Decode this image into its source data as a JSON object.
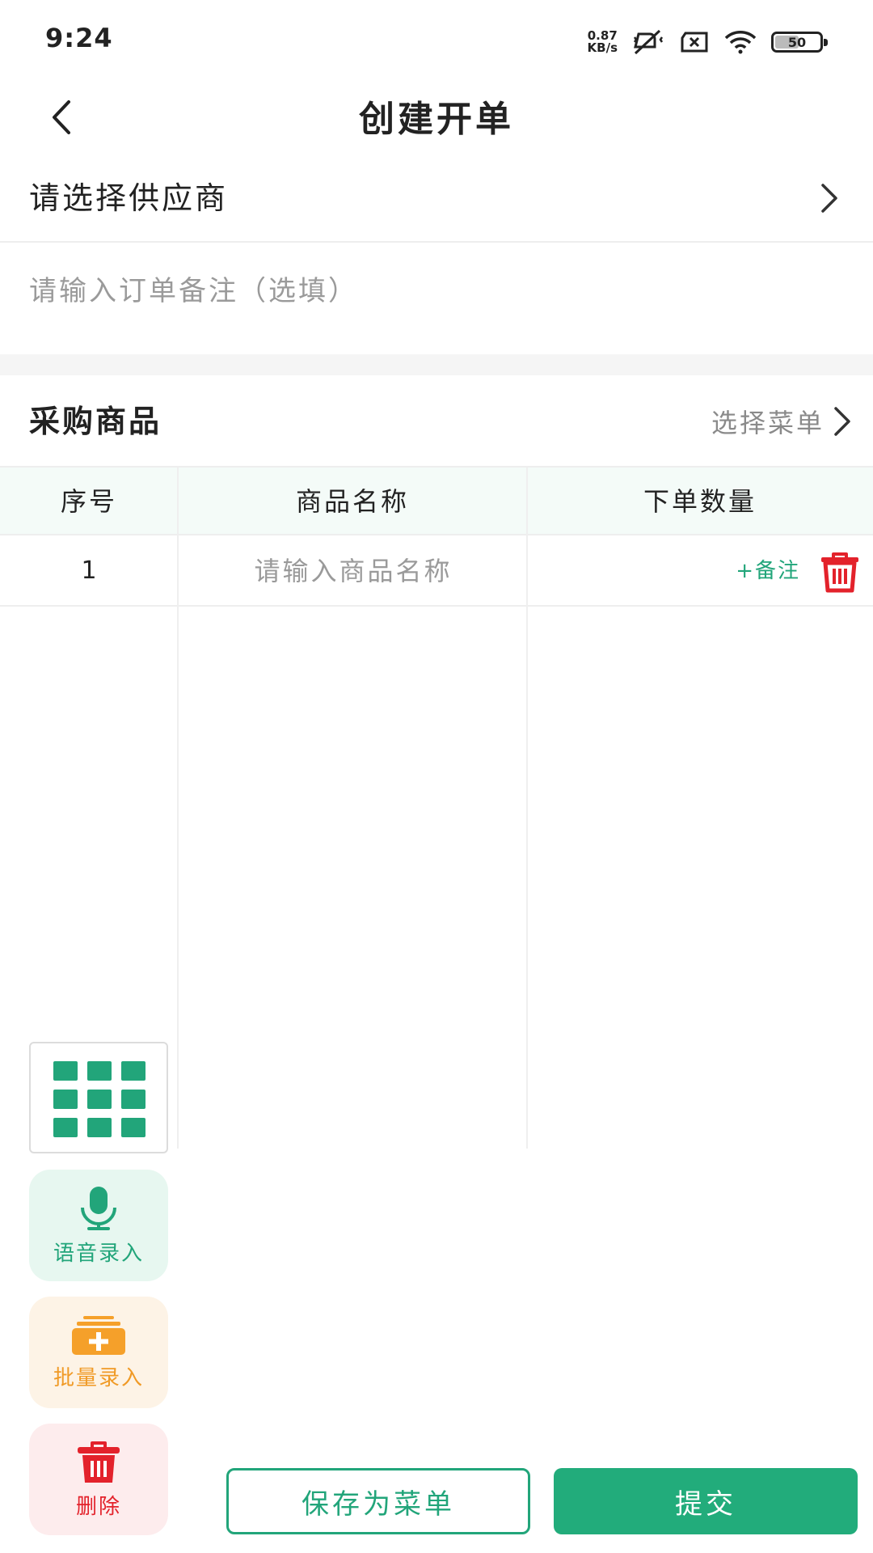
{
  "status_bar": {
    "time": "9:24",
    "net_speed_value": "0.87",
    "net_speed_unit": "KB/s",
    "battery_level": "50",
    "icons": [
      "net-speed-icon",
      "vibrate-off-icon",
      "sim-off-icon",
      "wifi-icon",
      "battery-icon"
    ]
  },
  "nav": {
    "title": "创建开单",
    "back_icon": "back-arrow-icon"
  },
  "supplier": {
    "label": "请选择供应商"
  },
  "remark": {
    "placeholder": "请输入订单备注（选填）"
  },
  "section": {
    "title": "采购商品",
    "choose_menu_label": "选择菜单"
  },
  "table": {
    "headers": [
      "序号",
      "商品名称",
      "下单数量"
    ],
    "rows": [
      {
        "index": "1",
        "name_placeholder": "请输入商品名称",
        "add_remark_label": "+备注"
      }
    ]
  },
  "tools": {
    "voice_label": "语音录入",
    "batch_label": "批量录入",
    "delete_label": "删除"
  },
  "actions": {
    "save_label": "保存为菜单",
    "submit_label": "提交"
  },
  "colors": {
    "brand_green": "#22AC7B",
    "danger_red": "#E3222B",
    "warning_orange": "#F5A02A",
    "voice_bg": "#E7F7F0",
    "batch_bg": "#FDF3E6",
    "delete_bg": "#FDECED"
  }
}
